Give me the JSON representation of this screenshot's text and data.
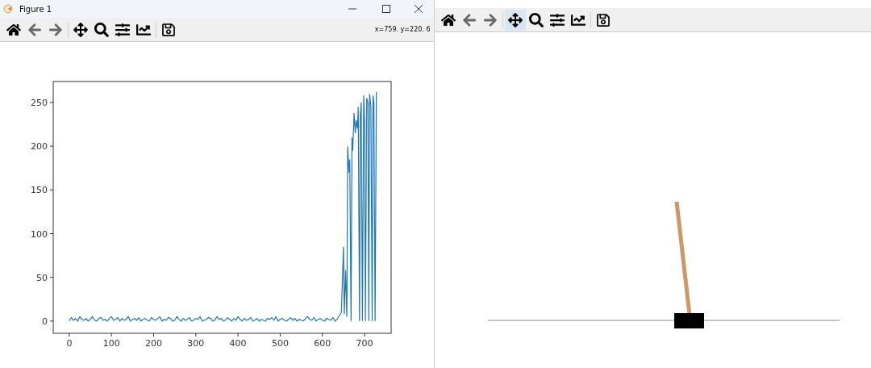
{
  "windows": [
    {
      "title": "Figure 1",
      "coordinates": "x=759.  y=220. 6",
      "toolbar": [
        {
          "kind": "home",
          "selected": false
        },
        {
          "kind": "back",
          "selected": false
        },
        {
          "kind": "forward",
          "selected": false
        },
        {
          "kind": "pan",
          "selected": false
        },
        {
          "kind": "zoom",
          "selected": false
        },
        {
          "kind": "configure",
          "selected": false
        },
        {
          "kind": "axes",
          "selected": false
        },
        {
          "kind": "save",
          "selected": false
        }
      ],
      "content": {
        "kind": "chart",
        "chart_data": {
          "type": "line",
          "x": [
            0,
            5,
            10,
            15,
            20,
            25,
            30,
            35,
            40,
            45,
            50,
            55,
            60,
            65,
            70,
            75,
            80,
            85,
            90,
            95,
            100,
            105,
            110,
            115,
            120,
            125,
            130,
            135,
            140,
            145,
            150,
            155,
            160,
            165,
            170,
            175,
            180,
            185,
            190,
            195,
            200,
            205,
            210,
            215,
            220,
            225,
            230,
            235,
            240,
            245,
            250,
            255,
            260,
            265,
            270,
            275,
            280,
            285,
            290,
            295,
            300,
            305,
            310,
            315,
            320,
            325,
            330,
            335,
            340,
            345,
            350,
            355,
            360,
            365,
            370,
            375,
            380,
            385,
            390,
            395,
            400,
            405,
            410,
            415,
            420,
            425,
            430,
            435,
            440,
            445,
            450,
            455,
            460,
            465,
            470,
            475,
            480,
            485,
            490,
            495,
            500,
            505,
            510,
            515,
            520,
            525,
            530,
            535,
            540,
            545,
            550,
            555,
            560,
            565,
            570,
            575,
            580,
            585,
            590,
            595,
            600,
            605,
            610,
            615,
            620,
            625,
            630,
            635,
            640,
            645,
            650,
            652,
            655,
            658,
            660,
            663,
            665,
            668,
            670,
            672,
            675,
            678,
            680,
            683,
            685,
            688,
            690,
            692,
            695,
            698,
            700,
            702,
            705,
            708,
            710,
            712,
            715,
            718,
            720,
            722,
            725,
            728
          ],
          "xlim": [
            -38,
            763
          ],
          "ylim": [
            -14,
            274
          ],
          "xticks": [
            0,
            100,
            200,
            300,
            400,
            500,
            600,
            700
          ],
          "yticks": [
            0,
            50,
            100,
            150,
            200,
            250
          ],
          "series": [
            {
              "color": "#1f77b4",
              "values": [
                0,
                4,
                1,
                3,
                0,
                5,
                2,
                1,
                3,
                0,
                2,
                5,
                1,
                0,
                3,
                4,
                1,
                2,
                0,
                3,
                5,
                1,
                2,
                4,
                0,
                3,
                1,
                2,
                5,
                0,
                2,
                3,
                1,
                4,
                0,
                2,
                3,
                1,
                0,
                4,
                2,
                1,
                3,
                5,
                0,
                2,
                1,
                4,
                3,
                0,
                1,
                5,
                2,
                0,
                3,
                1,
                2,
                4,
                0,
                1,
                3,
                2,
                5,
                0,
                1,
                2,
                4,
                3,
                0,
                1,
                5,
                2,
                3,
                0,
                1,
                4,
                2,
                0,
                3,
                1,
                5,
                2,
                0,
                3,
                1,
                2,
                4,
                0,
                1,
                3,
                0,
                2,
                1,
                0,
                3,
                2,
                4,
                1,
                5,
                0,
                2,
                3,
                1,
                0,
                2,
                4,
                1,
                3,
                0,
                2,
                1,
                0,
                3,
                5,
                2,
                1,
                4,
                0,
                2,
                3,
                1,
                0,
                3,
                2,
                1,
                4,
                0,
                2,
                6,
                10,
                85,
                8,
                58,
                5,
                200,
                170,
                185,
                0,
                210,
                195,
                238,
                215,
                230,
                220,
                245,
                0,
                235,
                250,
                0,
                258,
                230,
                0,
                255,
                250,
                0,
                260,
                245,
                0,
                258,
                250,
                0,
                262
              ]
            }
          ]
        }
      }
    },
    {
      "toolbar": [
        {
          "kind": "home",
          "selected": false
        },
        {
          "kind": "back",
          "selected": false
        },
        {
          "kind": "forward",
          "selected": false
        },
        {
          "kind": "pan",
          "selected": true
        },
        {
          "kind": "zoom",
          "selected": false
        },
        {
          "kind": "configure",
          "selected": false
        },
        {
          "kind": "axes",
          "selected": false
        },
        {
          "kind": "save",
          "selected": false
        }
      ],
      "content": {
        "kind": "render"
      }
    }
  ]
}
